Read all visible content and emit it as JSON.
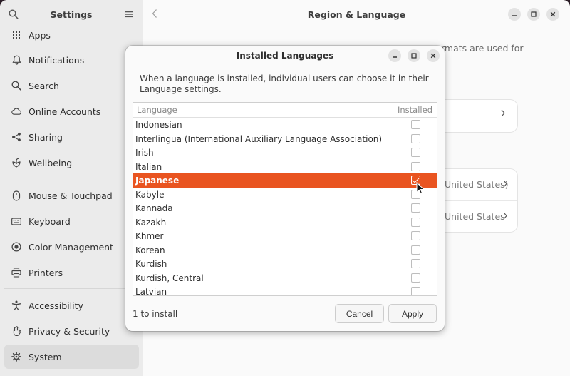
{
  "sidebar": {
    "title": "Settings",
    "items": [
      {
        "label": "Apps",
        "icon": "apps-grid-icon"
      },
      {
        "label": "Notifications",
        "icon": "bell-icon"
      },
      {
        "label": "Search",
        "icon": "search-icon"
      },
      {
        "label": "Online Accounts",
        "icon": "cloud-icon"
      },
      {
        "label": "Sharing",
        "icon": "share-icon"
      },
      {
        "label": "Wellbeing",
        "icon": "wellbeing-icon"
      },
      {
        "label": "Mouse & Touchpad",
        "icon": "mouse-icon"
      },
      {
        "label": "Keyboard",
        "icon": "keyboard-icon"
      },
      {
        "label": "Color Management",
        "icon": "palette-icon"
      },
      {
        "label": "Printers",
        "icon": "printer-icon"
      },
      {
        "label": "Accessibility",
        "icon": "accessibility-icon"
      },
      {
        "label": "Privacy & Security",
        "icon": "hand-icon"
      },
      {
        "label": "System",
        "icon": "gear-icon",
        "active": true
      }
    ]
  },
  "main": {
    "title": "Region & Language",
    "bg_text_formats": "rmats are used for",
    "bg_row_1_value": "United States)",
    "bg_row_2_value": "United States"
  },
  "dialog": {
    "title": "Installed Languages",
    "description": "When a language is installed, individual users can choose it in their Language settings.",
    "columns": {
      "language": "Language",
      "installed": "Installed"
    },
    "rows": [
      {
        "name": "Indonesian",
        "installed": false
      },
      {
        "name": "Interlingua (International Auxiliary Language Association)",
        "installed": false
      },
      {
        "name": "Irish",
        "installed": false
      },
      {
        "name": "Italian",
        "installed": false
      },
      {
        "name": "Japanese",
        "installed": true,
        "selected": true
      },
      {
        "name": "Kabyle",
        "installed": false
      },
      {
        "name": "Kannada",
        "installed": false
      },
      {
        "name": "Kazakh",
        "installed": false
      },
      {
        "name": "Khmer",
        "installed": false
      },
      {
        "name": "Korean",
        "installed": false
      },
      {
        "name": "Kurdish",
        "installed": false
      },
      {
        "name": "Kurdish, Central",
        "installed": false
      },
      {
        "name": "Latvian",
        "installed": false
      }
    ],
    "status": "1 to install",
    "cancel_label": "Cancel",
    "apply_label": "Apply"
  },
  "colors": {
    "accent": "#e95420",
    "sidebar_bg": "#ebebeb",
    "window_bg": "#fafafa"
  }
}
